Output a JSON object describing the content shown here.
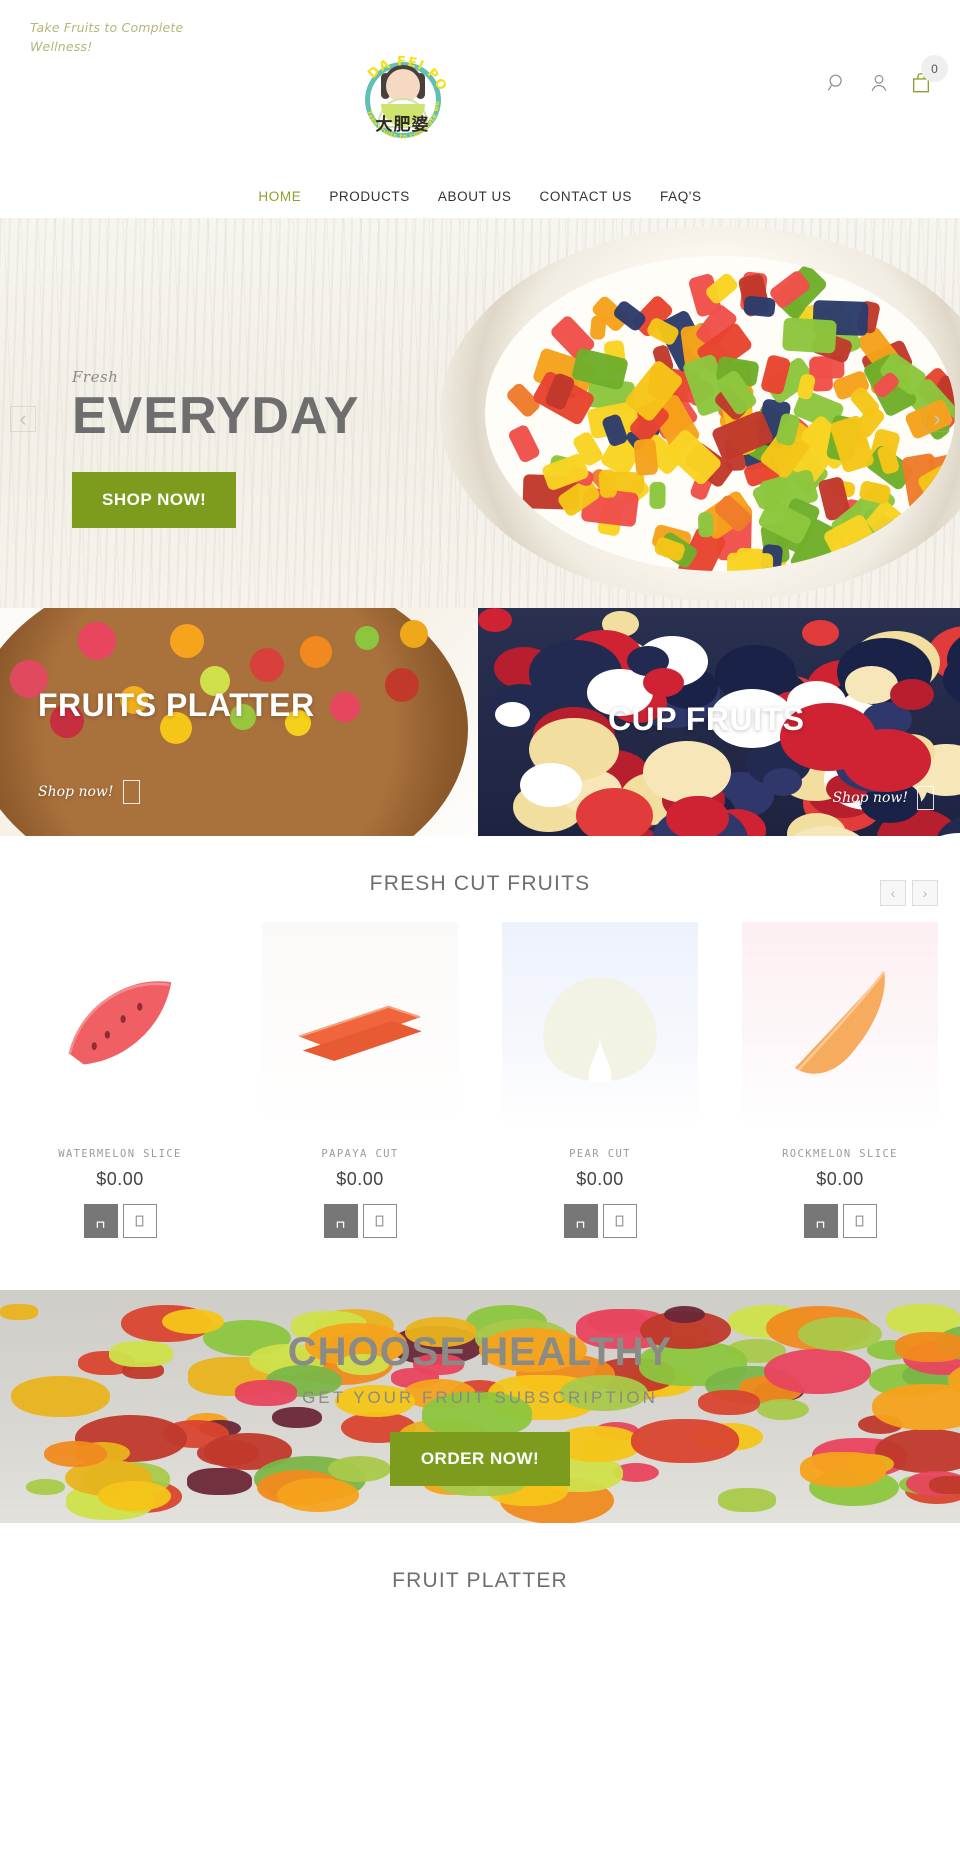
{
  "topbar": {
    "tagline": "Take Fruits to Complete Wellness!",
    "logo": {
      "arc_top": "DA FEI PO",
      "arc_bottom": "Take fruits to complete wellness",
      "chinese": "大肥婆"
    },
    "icons": {
      "search": "search-icon",
      "account": "account-icon",
      "bag": "shopping-bag-icon"
    },
    "cart_count": "0"
  },
  "nav": {
    "items": [
      {
        "label": "HOME",
        "active": true
      },
      {
        "label": "PRODUCTS",
        "active": false
      },
      {
        "label": "ABOUT US",
        "active": false
      },
      {
        "label": "CONTACT US",
        "active": false
      },
      {
        "label": "FAQ'S",
        "active": false
      }
    ]
  },
  "hero": {
    "eyebrow": "Fresh",
    "title": "EVERYDAY",
    "button": "SHOP NOW!",
    "prev": "‹",
    "next": "›"
  },
  "promos": [
    {
      "title": "FRUITS PLATTER",
      "link": "Shop now!"
    },
    {
      "title": "CUP FRUITS",
      "link": "Shop now!"
    }
  ],
  "products": {
    "section_title": "FRESH CUT FRUITS",
    "prev": "‹",
    "next": "›",
    "items": [
      {
        "name": "WATERMELON SLICE",
        "price": "$0.00"
      },
      {
        "name": "PAPAYA CUT",
        "price": "$0.00"
      },
      {
        "name": "PEAR CUT",
        "price": "$0.00"
      },
      {
        "name": "ROCKMELON SLICE",
        "price": "$0.00"
      }
    ],
    "cart_label": "🛒",
    "view_label": "♡"
  },
  "cta": {
    "heading": "CHOOSE HEALTHY",
    "subheading": "GET YOUR FRUIT SUBSCRIPTION",
    "button": "ORDER NOW!"
  },
  "bottom": {
    "title": "FRUIT PLATTER"
  },
  "colors": {
    "accent": "#7d9c1d",
    "nav_active": "#8aa32a",
    "tagline": "#b5b678",
    "heading": "#6e6e6e"
  }
}
